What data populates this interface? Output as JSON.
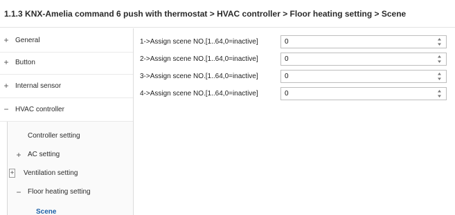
{
  "header": {
    "title": "1.1.3 KNX-Amelia command 6 push with thermostat > HVAC controller > Floor heating setting > Scene"
  },
  "sidebar": {
    "items": [
      {
        "sign": "+",
        "label": "General"
      },
      {
        "sign": "+",
        "label": "Button"
      },
      {
        "sign": "+",
        "label": "Internal sensor"
      },
      {
        "sign": "−",
        "label": "HVAC controller"
      }
    ],
    "subitems": [
      {
        "sign": "",
        "label": "Controller setting"
      },
      {
        "sign": "+",
        "label": "AC setting"
      },
      {
        "sign": "+",
        "label": "Ventilation setting"
      },
      {
        "sign": "−",
        "label": "Floor heating setting"
      },
      {
        "sign": "",
        "label": "Scene"
      }
    ]
  },
  "main": {
    "rows": [
      {
        "label": "1->Assign scene NO.[1..64,0=inactive]",
        "value": "0"
      },
      {
        "label": "2->Assign scene NO.[1..64,0=inactive]",
        "value": "0"
      },
      {
        "label": "3->Assign scene NO.[1..64,0=inactive]",
        "value": "0"
      },
      {
        "label": "4->Assign scene NO.[1..64,0=inactive]",
        "value": "0"
      }
    ]
  },
  "colors": {
    "selected_text": "#1c5fa6",
    "border": "#bdbdbd"
  },
  "icons": {
    "expand": "plus-icon",
    "collapse": "minus-icon",
    "spin": "spin-arrows-icon"
  }
}
